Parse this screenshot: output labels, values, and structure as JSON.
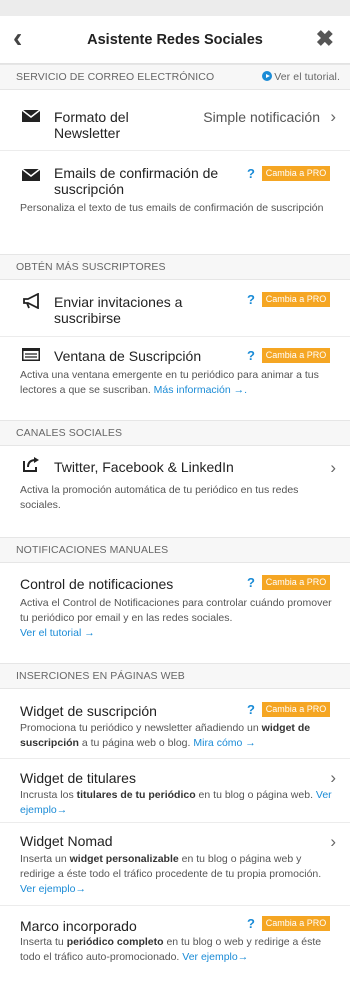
{
  "header": {
    "title": "Asistente Redes Sociales",
    "back_icon": "‹",
    "close_icon": "✖"
  },
  "sections": {
    "email": "SERVICIO DE CORREO ELECTRÓNICO",
    "tutorial_link": "Ver el tutorial.",
    "subscribers": "OBTÉN MÁS SUSCRIPTORES",
    "social": "CANALES SOCIALES",
    "manual": "NOTIFICACIONES MANUALES",
    "web": "INSERCIONES EN PÁGINAS WEB"
  },
  "pro_badge": "Cambia a PRO",
  "help_mark": "?",
  "items": {
    "newsletter": {
      "label": "Formato del Newsletter",
      "value": "Simple notificación"
    },
    "confirm": {
      "label": "Emails de confirmación de suscripción",
      "desc": "Personaliza el texto de tus emails de confirmación de suscripción"
    },
    "invite": {
      "label": "Enviar invitaciones a suscribirse"
    },
    "window": {
      "label": "Ventana de Suscripción",
      "desc": "Activa una ventana emergente en tu periódico para animar a tus lectores a que se suscriban.",
      "link": "Más información →."
    },
    "social": {
      "label": "Twitter, Facebook & LinkedIn",
      "desc": "Activa la promoción automática de tu periódico en tus redes sociales."
    },
    "control": {
      "label": "Control de notificaciones",
      "desc": "Activa el Control de Notificaciones para controlar cuándo promover tu periódico por email y en las redes sociales.",
      "link": "Ver el tutorial →"
    },
    "widget_sub": {
      "label": "Widget de suscripción",
      "desc_a": "Promociona tu periódico y newsletter añadiendo un ",
      "desc_b": "widget de suscripción",
      "desc_c": " a tu página web o blog. ",
      "link": "Mira cómo →"
    },
    "widget_titles": {
      "label": "Widget de titulares",
      "desc_a": "Incrusta los ",
      "desc_b": "titulares de tu periódico",
      "desc_c": " en tu blog o página web. ",
      "link": "Ver ejemplo→"
    },
    "widget_nomad": {
      "label": "Widget Nomad",
      "desc_a": "Inserta un ",
      "desc_b": "widget personalizable",
      "desc_c": " en tu blog o página web y redirige a éste todo el tráfico procedente de tu propia promoción. ",
      "link": "Ver ejemplo→"
    },
    "frame": {
      "label": "Marco incorporado",
      "desc_a": "Inserta tu ",
      "desc_b": "periódico completo",
      "desc_c": " en tu blog o web y redirige a éste todo el tráfico auto-promocionado. ",
      "link": "Ver ejemplo→"
    }
  },
  "colors": {
    "accent": "#1a8bd6",
    "pro": "#f5a623"
  }
}
